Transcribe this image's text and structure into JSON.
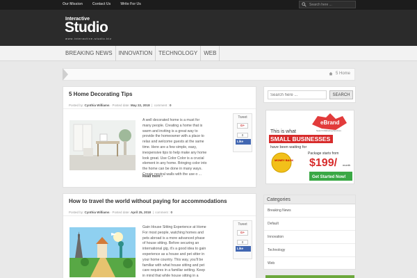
{
  "topbar": {
    "links": [
      "Our Mission",
      "Contact Us",
      "Write For Us"
    ],
    "search_placeholder": "Search here ..."
  },
  "logo": {
    "small": "Interactive",
    "big": "Studio",
    "url": "www.interactive-studio.biz"
  },
  "nav": {
    "items": [
      "BREAKING NEWS",
      "INNOVATION",
      "TECHNOLOGY",
      "WEB"
    ]
  },
  "breadcrumb": {
    "current": "5 Home"
  },
  "posts": [
    {
      "title": "5 Home Decorating Tips",
      "meta_posted_by_label": "Posted by:",
      "author": "Cynthia Williams",
      "date_label": "Posted date:",
      "date": "May 22, 2018",
      "comment_label": "comment :",
      "comments": "0",
      "excerpt": "A well decorated home is a must for many people. Creating a home that is warm and inviting is a great way to provide the homeowner with a place to relax and welcome guests at the same time. Here are a few simple, easy, inexpensive tips to help make any home look great. Use Color Color is a crucial element in any home. Bringing color into the home can be done in many ways. Create neutral walls with the use o ...",
      "read_more": "Read more",
      "share": {
        "tweet": "Tweet",
        "gplus": "G+",
        "count": "0",
        "fb": "Like"
      }
    },
    {
      "title": "How to travel the world without paying for accommodations",
      "meta_posted_by_label": "Posted by:",
      "author": "Cynthia Williams",
      "date_label": "Posted date:",
      "date": "April 25, 2018",
      "comment_label": "comment :",
      "comments": "0",
      "excerpt": "Gain House Sitting Experience at Home For most people, watching homes and pets abroad is a more advanced phase of house sitting. Before securing an international gig, it's a good idea to gain experience as a house and pet sitter in your home country. This way, you'll be familiar with what house sitting and pet care requires in a familiar setting. Keep in mind that while house sitting in a foreign country so ...",
      "share": {
        "tweet": "Tweet",
        "gplus": "G+",
        "count": "0",
        "fb": "Like"
      }
    }
  ],
  "sidebar": {
    "search_placeholder": "Search here ...",
    "search_button": "SEARCH",
    "ad": {
      "brand": "eBrand",
      "brand_sub": "Search Marketing Services",
      "line1": "This is what",
      "line2": "SMALL BUSINESSES",
      "line3": "have been waiting for",
      "pkg": "Package starts from",
      "price": "$199/",
      "per": "month",
      "badge": "MONEY BACK",
      "cta": "Get Started Now!"
    },
    "categories_title": "Categories",
    "categories": [
      "Breaking News",
      "Default",
      "Innovation",
      "Technology",
      "Web"
    ]
  }
}
